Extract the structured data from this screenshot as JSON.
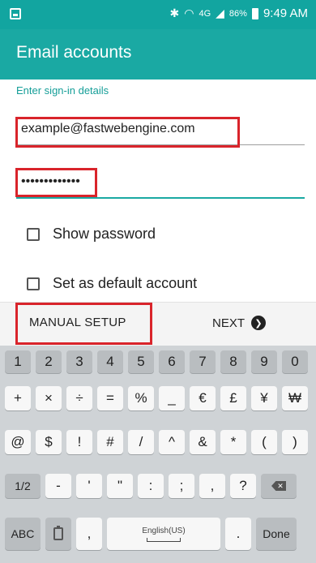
{
  "status_bar": {
    "time": "9:49 AM",
    "battery": "86%",
    "network": "4G"
  },
  "app_bar": {
    "title": "Email accounts"
  },
  "form": {
    "subheader": "Enter sign-in details",
    "email_value": "example@fastwebengine.com",
    "password_value": "•••••••••••••",
    "show_password_label": "Show password",
    "default_account_label": "Set as default account"
  },
  "buttons": {
    "manual_setup": "MANUAL SETUP",
    "next": "NEXT"
  },
  "keyboard": {
    "row1": [
      "1",
      "2",
      "3",
      "4",
      "5",
      "6",
      "7",
      "8",
      "9",
      "0"
    ],
    "row2": [
      "+",
      "×",
      "÷",
      "=",
      "%",
      "_",
      "€",
      "£",
      "¥",
      "₩"
    ],
    "row3": [
      "@",
      "$",
      "!",
      "#",
      "/",
      "^",
      "&",
      "*",
      "(",
      ")"
    ],
    "row4": [
      "1/2",
      "-",
      "'",
      "\"",
      ":",
      ";",
      ",",
      "?"
    ],
    "row5": {
      "abc": "ABC",
      "comma": ",",
      "space": "English(US)",
      "period": ".",
      "done": "Done"
    }
  },
  "colors": {
    "accent": "#1aa9a3",
    "highlight": "#d9242b"
  }
}
